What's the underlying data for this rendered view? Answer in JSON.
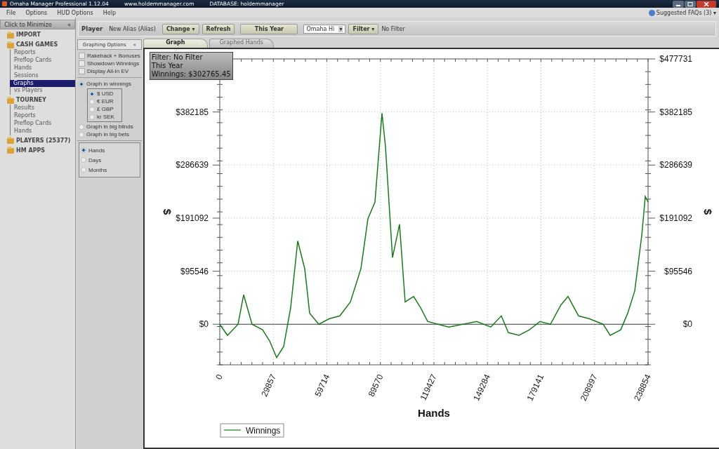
{
  "window": {
    "title": "Omaha Manager Professional 1.12.04",
    "website": "www.holdemmanager.com",
    "database": "DATABASE: holdemmanager"
  },
  "menu": [
    "File",
    "Options",
    "HUD Options",
    "Help"
  ],
  "faq": {
    "label": "Suggested FAQs (3)",
    "caret": "▾"
  },
  "sidebar": {
    "minimize": {
      "label": "Click to Minimize",
      "glyph": "«"
    },
    "items": [
      {
        "label": "IMPORT",
        "selected": false
      },
      {
        "label": "CASH GAMES",
        "selected": false,
        "children": [
          {
            "label": "Reports",
            "selected": false
          },
          {
            "label": "Preflop Cards",
            "selected": false
          },
          {
            "label": "Hands",
            "selected": false
          },
          {
            "label": "Sessions",
            "selected": false
          },
          {
            "label": "Graphs",
            "selected": true
          },
          {
            "label": "vs Players",
            "selected": false
          }
        ]
      },
      {
        "label": "TOURNEY",
        "selected": false,
        "children": [
          {
            "label": "Results",
            "selected": false
          },
          {
            "label": "Reports",
            "selected": false
          },
          {
            "label": "Preflop Cards",
            "selected": false
          },
          {
            "label": "Hands",
            "selected": false
          }
        ]
      },
      {
        "label": "PLAYERS (25377)",
        "selected": false
      },
      {
        "label": "HM APPS",
        "selected": false
      }
    ]
  },
  "toolbar": {
    "player_label": "Player",
    "player": "New Alias (Alias)",
    "change": "Change",
    "refresh": "Refresh",
    "period": "This Year",
    "game": "Omaha Hi",
    "filter": "Filter",
    "caret": "▾",
    "filter_status": "No Filter"
  },
  "options": {
    "title": "Graphing Options",
    "glyph": "«",
    "checkboxes": [
      {
        "label": "Rakeback + Bonuses",
        "checked": false
      },
      {
        "label": "Showdown Winnings",
        "checked": false
      },
      {
        "label": "Display All-In EV",
        "checked": false
      }
    ],
    "units": [
      {
        "label": "Graph in winnings",
        "selected": true,
        "currencies": [
          {
            "label": "$ USD",
            "selected": true
          },
          {
            "label": "€ EUR",
            "selected": false
          },
          {
            "label": "£ GBP",
            "selected": false
          },
          {
            "label": "kr SEK",
            "selected": false
          }
        ]
      },
      {
        "label": "Graph in big blinds",
        "selected": false
      },
      {
        "label": "Graph in big bets",
        "selected": false
      }
    ],
    "x_axis": [
      {
        "label": "Hands",
        "selected": true
      },
      {
        "label": "Days",
        "selected": false
      },
      {
        "label": "Months",
        "selected": false
      }
    ]
  },
  "tabs": [
    {
      "label": "Graph",
      "selected": true
    },
    {
      "label": "Graphed Hands",
      "selected": false
    }
  ],
  "graph": {
    "info": [
      "Filter: No Filter",
      "This Year",
      "Winnings: $302765.45"
    ],
    "y2label": "$",
    "chart_data": {
      "type": "line",
      "grid": true,
      "xlabel": "Hands",
      "ylabel": "$",
      "x": [
        0,
        4307,
        10181,
        13313,
        18012,
        23885,
        27801,
        31716,
        35632,
        39548,
        43463,
        47379,
        50120,
        55209,
        61083,
        66957,
        72830,
        78704,
        82620,
        86535,
        90451,
        92409,
        96324,
        100239,
        103372,
        108070,
        111986,
        115902,
        121775,
        127649,
        135480,
        143311,
        151142,
        157016,
        160931,
        166805,
        172678,
        178551,
        184425,
        190298,
        194214,
        200087,
        205960,
        213792,
        217707,
        223581,
        227496,
        231412,
        235327,
        237285,
        238854
      ],
      "series": [
        {
          "name": "Winnings",
          "color": "#1a7a1a",
          "values": [
            0,
            -20000,
            0,
            53000,
            0,
            -10000,
            -30000,
            -60000,
            -40000,
            30000,
            150000,
            100000,
            20000,
            0,
            10000,
            15000,
            40000,
            100000,
            190000,
            220000,
            380000,
            320000,
            120000,
            180000,
            40000,
            50000,
            30000,
            5000,
            0,
            -5000,
            0,
            5000,
            -5000,
            15000,
            -15000,
            -20000,
            -10000,
            5000,
            0,
            35000,
            50000,
            15000,
            10000,
            0,
            -20000,
            -10000,
            20000,
            60000,
            160000,
            230000,
            220000
          ]
        }
      ],
      "xlim": [
        0,
        238854
      ],
      "ylim": [
        -73000,
        477731
      ],
      "xticks": [
        0,
        29857,
        59714,
        89570,
        119427,
        149284,
        179141,
        208997,
        238854
      ],
      "yticks": [
        {
          "value": 0,
          "label": "$0"
        },
        {
          "value": 95546,
          "label": "$95546"
        },
        {
          "value": 191092,
          "label": "$191092"
        },
        {
          "value": 286639,
          "label": "$286639"
        },
        {
          "value": 382185,
          "label": "$382185"
        },
        {
          "value": 477731,
          "label": "$477731"
        }
      ]
    }
  }
}
